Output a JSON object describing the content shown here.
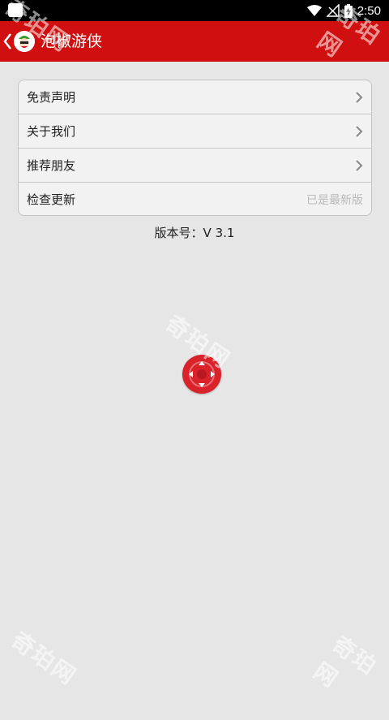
{
  "status_bar": {
    "time": "2:50",
    "icons": [
      "notification-icon",
      "wifi-icon",
      "no-signal-icon",
      "battery-charging-icon"
    ]
  },
  "app_bar": {
    "title": "泡椒游侠",
    "icons": [
      "back-arrow-icon",
      "app-logo-icon"
    ],
    "color": "#d01010"
  },
  "menu": {
    "items": [
      {
        "label": "免责声明",
        "icon": "chevron-right-icon"
      },
      {
        "label": "关于我们",
        "icon": "chevron-right-icon"
      },
      {
        "label": "推荐朋友",
        "icon": "chevron-right-icon"
      },
      {
        "label": "检查更新",
        "status": "已是最新版"
      }
    ]
  },
  "version_text": "版本号：V 3.1",
  "floating_button": {
    "icon": "gamepad-dpad-icon",
    "color": "#d9222a"
  },
  "watermark": "奇珀网"
}
